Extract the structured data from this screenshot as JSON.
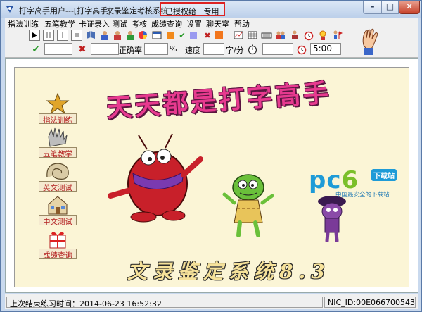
{
  "window": {
    "title": "打字高手用户---[打字高手]",
    "system_name": "文录鉴定考核系统",
    "auth_text": "已授权给   专用"
  },
  "menu": [
    "指法训练",
    "五笔教学",
    "卡证录入",
    "测试",
    "考核",
    "成绩查询",
    "设置",
    "聊天室",
    "帮助"
  ],
  "toolbar": {
    "accuracy_label": "正确率",
    "percent_unit": "%",
    "speed_label": "速度",
    "speed_unit": "字/分",
    "timer_value": "5:00"
  },
  "side_buttons": [
    "指法训练",
    "五笔教学",
    "英文测试",
    "中文测试",
    "成绩查询"
  ],
  "banner": {
    "headline": "天天都是打字高手",
    "subline": "文录鉴定系统8.3"
  },
  "watermark": {
    "brand_main": "pc",
    "brand_num": "6",
    "brand_tag": "下载站",
    "brand_sub": "中国最安全的下载站"
  },
  "status": {
    "last_practice": "上次结束练习时间：2014-06-23   16:52:32",
    "nic_id": "NIC_ID:00E066700543"
  },
  "colors": {
    "panel_bg": "#fbf5d6",
    "headline": "#e73a8f",
    "auth_box_border": "#d22"
  }
}
